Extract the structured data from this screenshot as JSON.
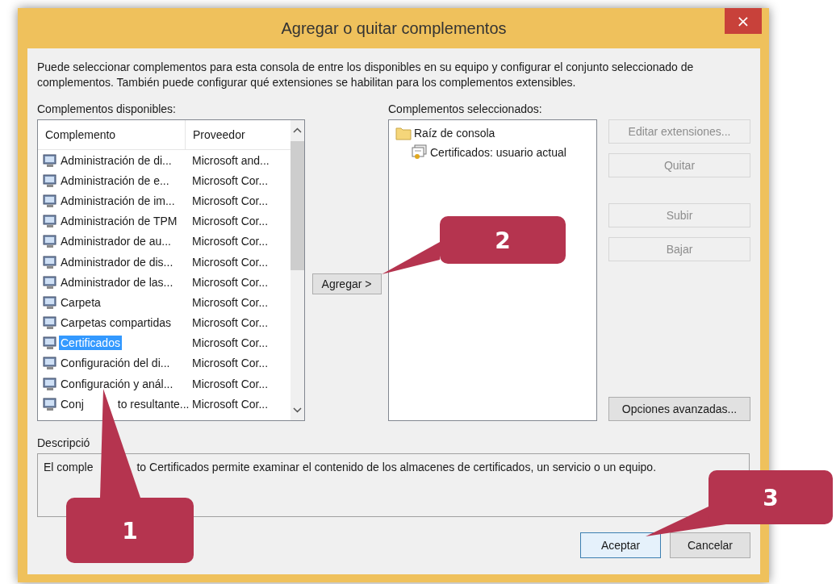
{
  "window": {
    "title": "Agregar o quitar complementos",
    "close": "×"
  },
  "intro": "Puede seleccionar complementos para esta consola de entre los disponibles en su equipo y configurar el conjunto seleccionado de complementos. También puede configurar qué extensiones se habilitan para los complementos extensibles.",
  "available": {
    "label": "Complementos disponibles:",
    "columns": [
      "Complemento",
      "Proveedor"
    ],
    "rows": [
      {
        "name": "Administración de di...",
        "vendor": "Microsoft and...",
        "selected": false
      },
      {
        "name": "Administración de e...",
        "vendor": "Microsoft Cor...",
        "selected": false
      },
      {
        "name": "Administración de im...",
        "vendor": "Microsoft Cor...",
        "selected": false
      },
      {
        "name": "Administración de TPM",
        "vendor": "Microsoft Cor...",
        "selected": false
      },
      {
        "name": "Administrador de au...",
        "vendor": "Microsoft Cor...",
        "selected": false
      },
      {
        "name": "Administrador de dis...",
        "vendor": "Microsoft Cor...",
        "selected": false
      },
      {
        "name": "Administrador de las...",
        "vendor": "Microsoft Cor...",
        "selected": false
      },
      {
        "name": "Carpeta",
        "vendor": "Microsoft Cor...",
        "selected": false
      },
      {
        "name": "Carpetas compartidas",
        "vendor": "Microsoft Cor...",
        "selected": false
      },
      {
        "name": "Certificados",
        "vendor": "Microsoft Cor...",
        "selected": true
      },
      {
        "name": "Configuración del di...",
        "vendor": "Microsoft Cor...",
        "selected": false
      },
      {
        "name": "Configuración y anál...",
        "vendor": "Microsoft Cor...",
        "selected": false
      },
      {
        "name_parts": [
          "Conj",
          "to resultante..."
        ],
        "vendor": "Microsoft Cor...",
        "selected": false
      }
    ]
  },
  "add_button": "Agregar >",
  "selected_snapins": {
    "label": "Complementos seleccionados:",
    "tree": [
      {
        "label": "Raíz de consola",
        "children": [
          {
            "label": "Certificados: usuario actual"
          }
        ]
      }
    ]
  },
  "side_buttons": [
    {
      "label": "Editar extensiones...",
      "disabled": true
    },
    {
      "label": "Quitar",
      "disabled": true
    },
    {
      "label": "Subir",
      "disabled": true
    },
    {
      "label": "Bajar",
      "disabled": true
    }
  ],
  "advanced_button": "Opciones avanzadas...",
  "description": {
    "label": "Descripció",
    "text_parts": [
      "El comple",
      "to Certificados permite examinar el contenido de los almacenes de certificados, un servicio o un equipo."
    ]
  },
  "buttons": [
    {
      "label": "Aceptar",
      "default": true
    },
    {
      "label": "Cancelar",
      "default": false
    }
  ],
  "callouts": [
    "1",
    "2",
    "3"
  ]
}
